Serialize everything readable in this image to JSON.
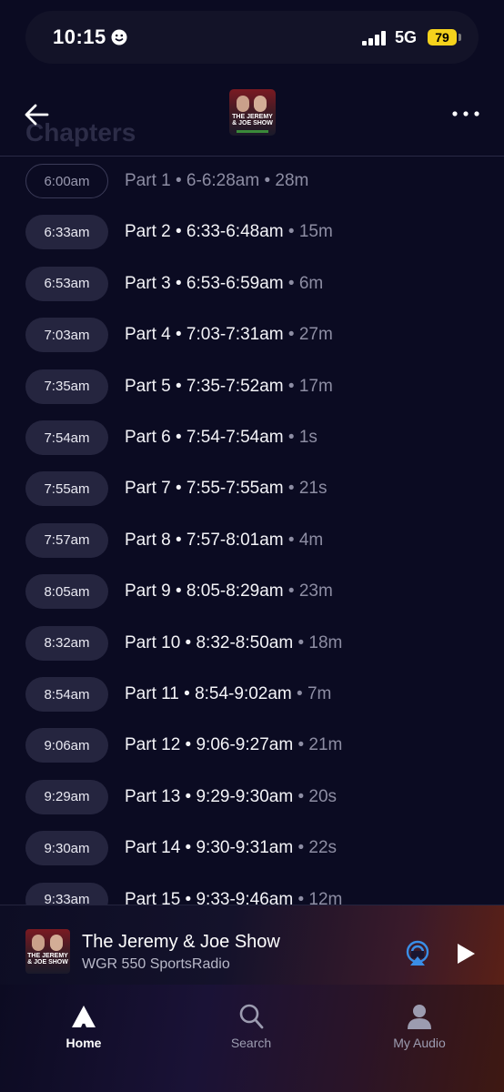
{
  "status_bar": {
    "time": "10:15",
    "network": "5G",
    "battery": "79",
    "accent": "#f5d21c"
  },
  "header": {
    "ghost_title": "Chapters",
    "cover_text": "THE JEREMY & JOE SHOW",
    "icons": [
      "back-arrow-icon",
      "more-icon"
    ]
  },
  "chapters": [
    {
      "time": "6:00am",
      "part": "Part 1",
      "range": "6-6:28am",
      "duration": "28m",
      "state": "played"
    },
    {
      "time": "6:33am",
      "part": "Part 2",
      "range": "6:33-6:48am",
      "duration": "15m"
    },
    {
      "time": "6:53am",
      "part": "Part 3",
      "range": "6:53-6:59am",
      "duration": "6m"
    },
    {
      "time": "7:03am",
      "part": "Part 4",
      "range": "7:03-7:31am",
      "duration": "27m"
    },
    {
      "time": "7:35am",
      "part": "Part 5",
      "range": "7:35-7:52am",
      "duration": "17m"
    },
    {
      "time": "7:54am",
      "part": "Part 6",
      "range": "7:54-7:54am",
      "duration": "1s"
    },
    {
      "time": "7:55am",
      "part": "Part 7",
      "range": "7:55-7:55am",
      "duration": "21s"
    },
    {
      "time": "7:57am",
      "part": "Part 8",
      "range": "7:57-8:01am",
      "duration": "4m"
    },
    {
      "time": "8:05am",
      "part": "Part 9",
      "range": "8:05-8:29am",
      "duration": "23m"
    },
    {
      "time": "8:32am",
      "part": "Part 10",
      "range": "8:32-8:50am",
      "duration": "18m"
    },
    {
      "time": "8:54am",
      "part": "Part 11",
      "range": "8:54-9:02am",
      "duration": "7m"
    },
    {
      "time": "9:06am",
      "part": "Part 12",
      "range": "9:06-9:27am",
      "duration": "21m"
    },
    {
      "time": "9:29am",
      "part": "Part 13",
      "range": "9:29-9:30am",
      "duration": "20s"
    },
    {
      "time": "9:30am",
      "part": "Part 14",
      "range": "9:30-9:31am",
      "duration": "22s"
    },
    {
      "time": "9:33am",
      "part": "Part 15",
      "range": "9:33-9:46am",
      "duration": "12m"
    }
  ],
  "mini_player": {
    "title": "The Jeremy & Joe Show",
    "subtitle": "WGR 550 SportsRadio",
    "cover_text": "THE JEREMY & JOE SHOW",
    "airplay_color": "#3a8ee6",
    "icons": [
      "airplay-icon",
      "play-icon"
    ]
  },
  "tabs": [
    {
      "label": "Home",
      "icon": "home-logo-icon",
      "active": true
    },
    {
      "label": "Search",
      "icon": "search-icon",
      "active": false
    },
    {
      "label": "My Audio",
      "icon": "person-icon",
      "active": false
    }
  ]
}
